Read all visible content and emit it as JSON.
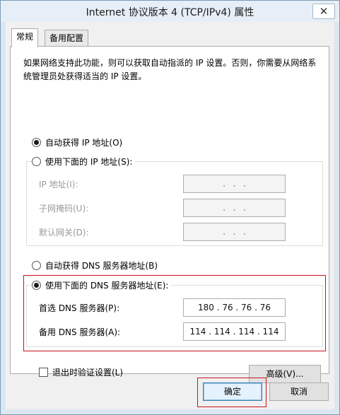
{
  "window": {
    "title": "Internet 协议版本 4 (TCP/IPv4) 属性",
    "close_glyph": "✕"
  },
  "tabs": [
    {
      "label": "常规",
      "active": true
    },
    {
      "label": "备用配置",
      "active": false
    }
  ],
  "description": "如果网络支持此功能，则可以获取自动指派的 IP 设置。否则，你需要从网络系统管理员处获得适当的 IP 设置。",
  "ip_section": {
    "auto_option": {
      "label": "自动获得 IP 地址(O)",
      "checked": true
    },
    "manual_option": {
      "label": "使用下面的 IP 地址(S):",
      "checked": false
    },
    "fields": [
      {
        "label": "IP 地址(I):",
        "value": ".       .       ."
      },
      {
        "label": "子网掩码(U):",
        "value": ".       .       ."
      },
      {
        "label": "默认网关(D):",
        "value": ".       .       ."
      }
    ]
  },
  "dns_section": {
    "auto_option": {
      "label": "自动获得 DNS 服务器地址(B)",
      "checked": false
    },
    "manual_option": {
      "label": "使用下面的 DNS 服务器地址(E):",
      "checked": true
    },
    "fields": [
      {
        "label": "首选 DNS 服务器(P):",
        "value": "180 . 76 . 76 . 76"
      },
      {
        "label": "备用 DNS 服务器(A):",
        "value": "114 . 114 . 114 . 114"
      }
    ]
  },
  "validate_on_exit": {
    "label": "退出时验证设置(L)",
    "checked": false
  },
  "buttons": {
    "advanced": "高级(V)...",
    "ok": "确定",
    "cancel": "取消"
  },
  "colors": {
    "highlight_border": "#c8141e",
    "title_bar": "#e6eef7"
  }
}
